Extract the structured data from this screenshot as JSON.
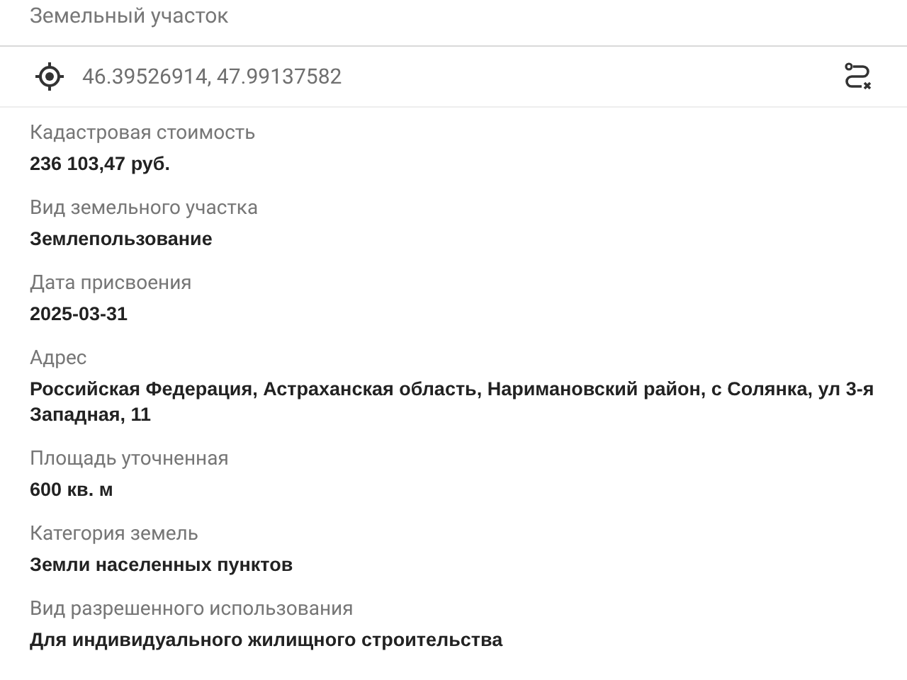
{
  "header": {
    "title": "Земельный участок"
  },
  "location": {
    "coordinates": "46.39526914, 47.99137582"
  },
  "fields": [
    {
      "label": "Кадастровая стоимость",
      "value": "236 103,47 руб."
    },
    {
      "label": "Вид земельного участка",
      "value": "Землепользование"
    },
    {
      "label": "Дата присвоения",
      "value": "2025-03-31"
    },
    {
      "label": "Адрес",
      "value": "Российская Федерация, Астраханская область, Наримановский район, с Солянка, ул 3-я Западная, 11"
    },
    {
      "label": "Площадь уточненная",
      "value": "600 кв. м"
    },
    {
      "label": "Категория земель",
      "value": "Земли населенных пунктов"
    },
    {
      "label": "Вид разрешенного использования",
      "value": "Для индивидуального жилищного строительства"
    }
  ]
}
